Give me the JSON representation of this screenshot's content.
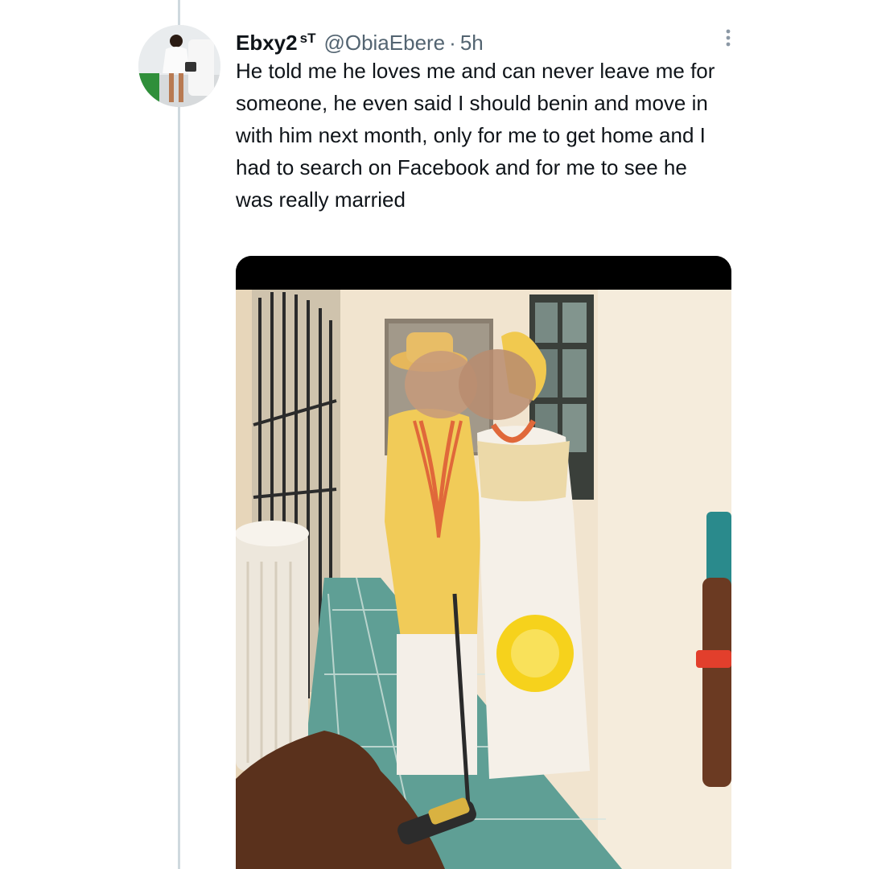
{
  "tweet": {
    "display_name": "Ebxy2",
    "name_suffix": "sT",
    "handle": "@ObiaEbere",
    "separator": "·",
    "time": "5h",
    "text": "He told me he loves me and can never leave me for someone, he even said I should benin and move in with him next month, only for me to get home and I had to search on Facebook and for me to see he was really married"
  },
  "icons": {
    "more": "more-vertical-icon"
  },
  "colors": {
    "text_primary": "#0f1419",
    "text_secondary": "#536471",
    "thread_line": "#cfd9de",
    "media_letterbox": "#000000"
  }
}
